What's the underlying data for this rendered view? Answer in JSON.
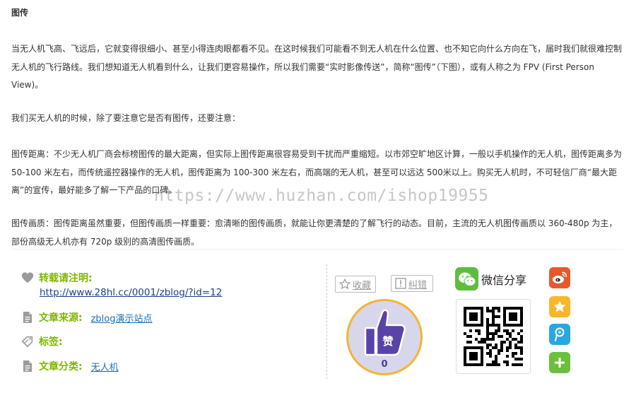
{
  "article": {
    "heading": "图传",
    "paragraphs": [
      "当无人机飞高、飞远后，它就变得很细小、甚至小得连肉眼都看不见。在这时候我们可能看不到无人机在什么位置、也不知它向什么方向在飞，届时我们就很难控制无人机的飞行路线。我们想知道无人机看到什么，让我们更容易操作，所以我们需要“实时影像传送”，简称“图传”（下图），或有人称之为 FPV (First Person View)。",
      "我们买无人机的时候，除了要注意它是否有图传，还要注意：",
      "图传距离：不少无人机厂商会标榜图传的最大距离，但实际上图传距离很容易受到干扰而严重缩短。以市郊空旷地区计算，一般以手机操作的无人机，图传距离多为 50-100 米左右，而传统遥控器操作的无人机，图传距离为 100-300 米左右，而高端的无人机，甚至可以远达 500米以上。购买无人机时，不可轻信厂商“最大距离”的宣传，最好能多了解一下产品的口碑。",
      "图传画质：图传距离虽然重要，但图传画质一样重要：愈清晰的图传画质，就能让你更清楚的了解飞行的动态。目前，主流的无人机图传画质以 360-480p 为主，部份高级无人机亦有 720p 级别的高清图传画质。"
    ]
  },
  "watermark": "https://www.huzhan.com/ishop19955",
  "meta": {
    "reprint_label": "转载请注明:",
    "reprint_url": "http://www.28hl.cc/0001/zblog/?id=12",
    "source_label": "文章来源:",
    "source_value": "zblog演示站点",
    "tags_label": "标签:",
    "category_label": "文章分类:",
    "category_value": "无人机"
  },
  "actions": {
    "favorite_label": "收藏",
    "report_label": "纠错",
    "like_count": "0",
    "like_badge": "赞"
  },
  "share": {
    "wechat_label": "微信分享",
    "icons": [
      "weibo-icon",
      "qzone-icon",
      "tencent-weibo-icon",
      "more-share-icon"
    ]
  },
  "colors": {
    "accent_green": "#80b600",
    "link_blue": "#1a6fb8",
    "like_border": "#f2b536",
    "like_fill": "#d8d6eb",
    "wechat_green": "#5ebd3f"
  }
}
